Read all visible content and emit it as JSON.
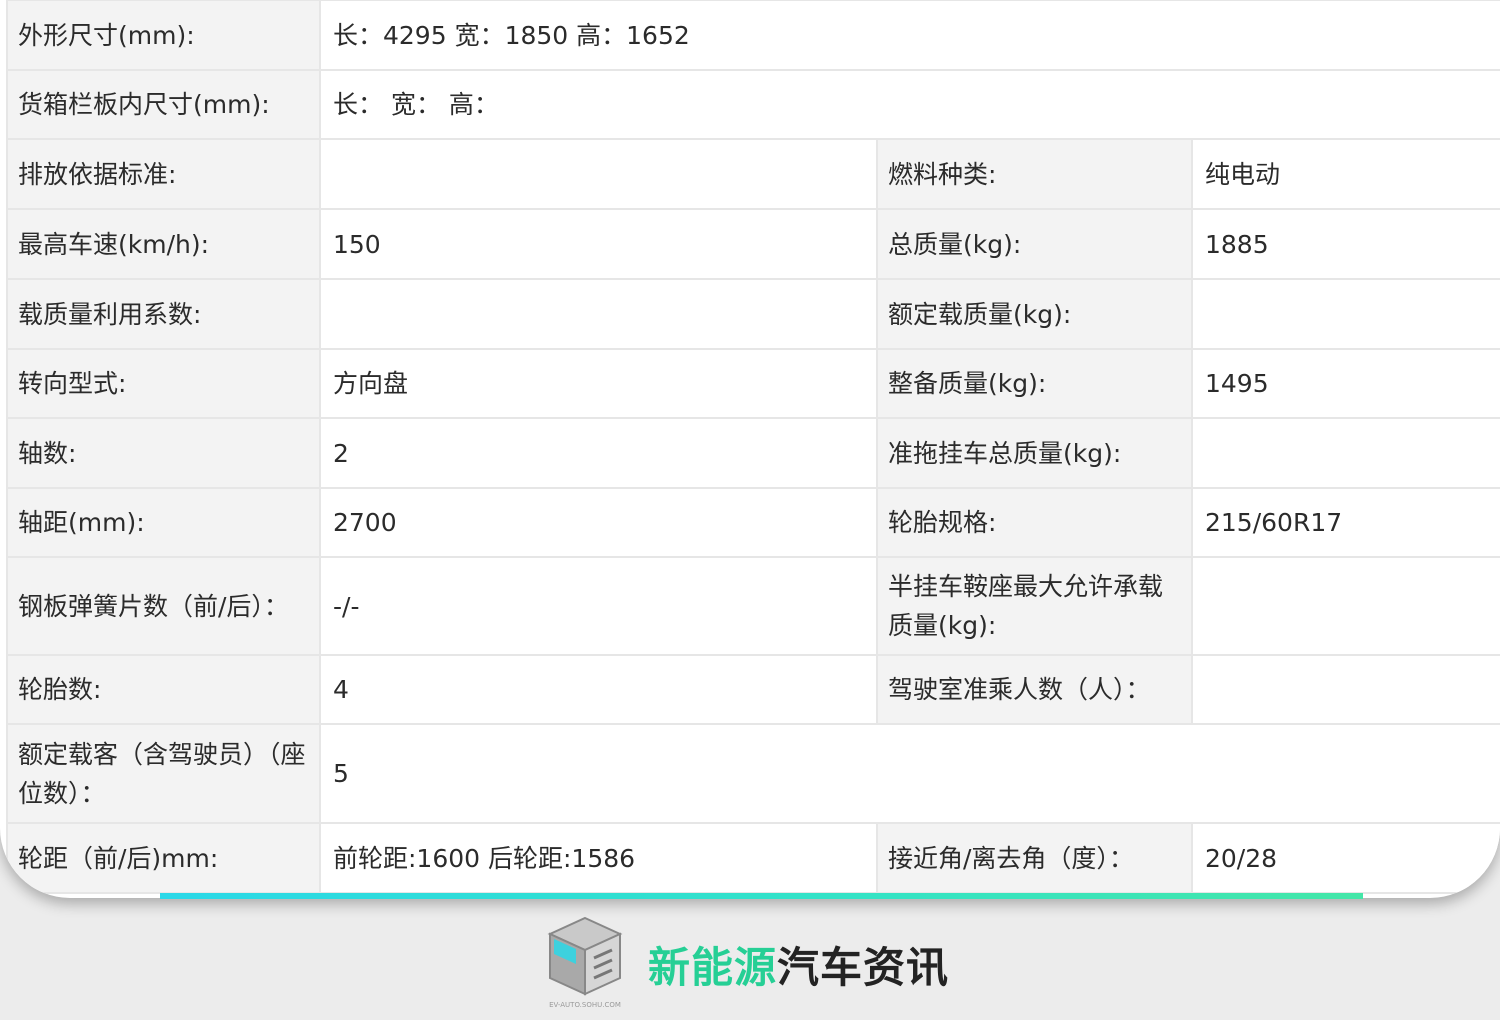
{
  "rows": [
    {
      "l1": "外形尺寸(mm):",
      "v1": "长：4295 宽：1850 高：1652"
    },
    {
      "l1": "货箱栏板内尺寸(mm):",
      "v1": "长：  宽：  高："
    },
    {
      "l1": "排放依据标准:",
      "v1": "",
      "l2": "燃料种类:",
      "v2": "纯电动"
    },
    {
      "l1": "最高车速(km/h):",
      "v1": "150",
      "l2": "总质量(kg):",
      "v2": "1885"
    },
    {
      "l1": "载质量利用系数:",
      "v1": "",
      "l2": "额定载质量(kg):",
      "v2": ""
    },
    {
      "l1": "转向型式:",
      "v1": "方向盘",
      "l2": "整备质量(kg):",
      "v2": "1495"
    },
    {
      "l1": "轴数:",
      "v1": "2",
      "l2": "准拖挂车总质量(kg):",
      "v2": ""
    },
    {
      "l1": "轴距(mm):",
      "v1": "2700",
      "l2": "轮胎规格:",
      "v2": "215/60R17"
    },
    {
      "l1": "钢板弹簧片数（前/后）：",
      "v1": "-/-",
      "l2": "半挂车鞍座最大允许承载质量(kg):",
      "v2": ""
    },
    {
      "l1": "轮胎数:",
      "v1": "4",
      "l2": "驾驶室准乘人数（人）：",
      "v2": ""
    },
    {
      "l1": "额定载客（含驾驶员）（座位数）：",
      "v1": "5"
    },
    {
      "l1": "轮距（前/后)mm:",
      "v1": "前轮距:1600 后轮距:1586",
      "l2": "接近角/离去角（度）：",
      "v2": "20/28"
    }
  ],
  "footer": {
    "brand_green": "新能源",
    "brand_dark": "汽车资讯",
    "logo_caption": "EV-AUTO.SOHU.COM"
  },
  "colors": {
    "accent": "#26cf95",
    "bar_start": "#2ad8e8",
    "label_bg": "#f3f3f3"
  }
}
